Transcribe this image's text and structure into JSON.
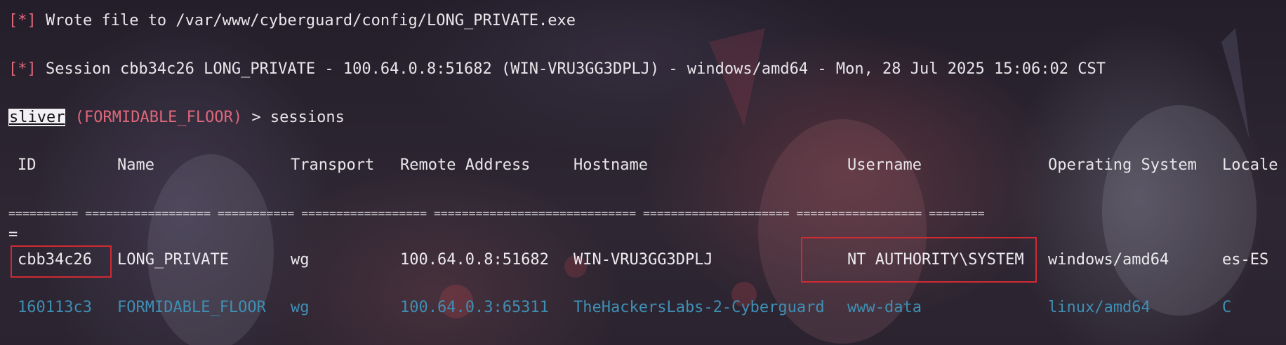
{
  "terminal": {
    "line1": {
      "tag": "[*]",
      "text": " Wrote file to /var/www/cyberguard/config/LONG_PRIVATE.exe"
    },
    "line2": {
      "tag": "[*]",
      "text": " Session cbb34c26 LONG_PRIVATE - 100.64.0.8:51682 (WIN-VRU3GG3DPLJ) - windows/amd64 - Mon, 28 Jul 2025 15:06:02 CST"
    },
    "prompt": {
      "name": "sliver",
      "session": "(FORMIDABLE_FLOOR)",
      "command": " > sessions"
    }
  },
  "table": {
    "headers": [
      "ID",
      "Name",
      "Transport",
      "Remote Address",
      "Hostname",
      "Username",
      "Operating System",
      "Locale"
    ],
    "separator": "========== ================== =========== ================== ============================= ===================== ================== ========",
    "separator_wrap": "=",
    "rows": [
      [
        "cbb34c26",
        "LONG_PRIVATE",
        "wg",
        "100.64.0.8:51682",
        "WIN-VRU3GG3DPLJ",
        "NT AUTHORITY\\SYSTEM",
        "windows/amd64",
        "es-ES"
      ],
      [
        "160113c3",
        "FORMIDABLE_FLOOR",
        "wg",
        "100.64.0.3:65311",
        "TheHackersLabs-2-Cyberguard",
        "www-data",
        "linux/amd64",
        "C"
      ]
    ]
  },
  "colors": {
    "accent_red": "#e0677a",
    "inactive_row_blue": "#3f8fb5",
    "highlight_box": "#d02a33"
  }
}
